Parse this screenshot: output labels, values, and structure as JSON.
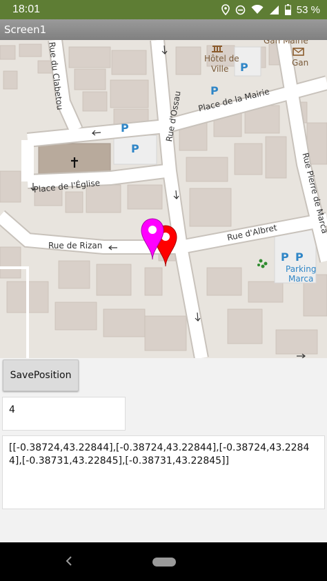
{
  "status": {
    "time": "18:01",
    "battery": "53 %",
    "icons": [
      "location-icon",
      "do-not-disturb-icon",
      "wifi-icon",
      "signal-icon",
      "battery-icon"
    ]
  },
  "app": {
    "title": "Screen1"
  },
  "map": {
    "streets": [
      "Rue du Clabetou",
      "Place de la Mairie",
      "Rue d'Ossau",
      "Place de l'Église",
      "Rue Pierre de Marca",
      "Rue d'Albret",
      "Rue de Rizan"
    ],
    "places": {
      "town_hall_line1": "Hôtel de",
      "town_hall_line2": "Ville",
      "post_office": "Gan",
      "top_right_cut": "Gan Mairie",
      "parking_line1": "Parking",
      "parking_line2": "Marca"
    },
    "parking_symbol": "P",
    "markers": [
      {
        "color": "#ff00ff",
        "name": "magenta-marker"
      },
      {
        "color": "#ff0000",
        "name": "red-marker"
      }
    ]
  },
  "controls": {
    "save_button": "SavePosition",
    "counter_value": "4",
    "positions_text": "[[-0.38724,43.22844],[-0.38724,43.22844],[-0.38724,43.22844],[-0.38731,43.22845],[-0.38731,43.22845]]"
  },
  "colors": {
    "status_bar": "#5e7d34",
    "title_bar": "#8c8c8c",
    "road": "#ffffff",
    "building": "#d9d0c9",
    "parking_blue": "#2f86c7"
  }
}
